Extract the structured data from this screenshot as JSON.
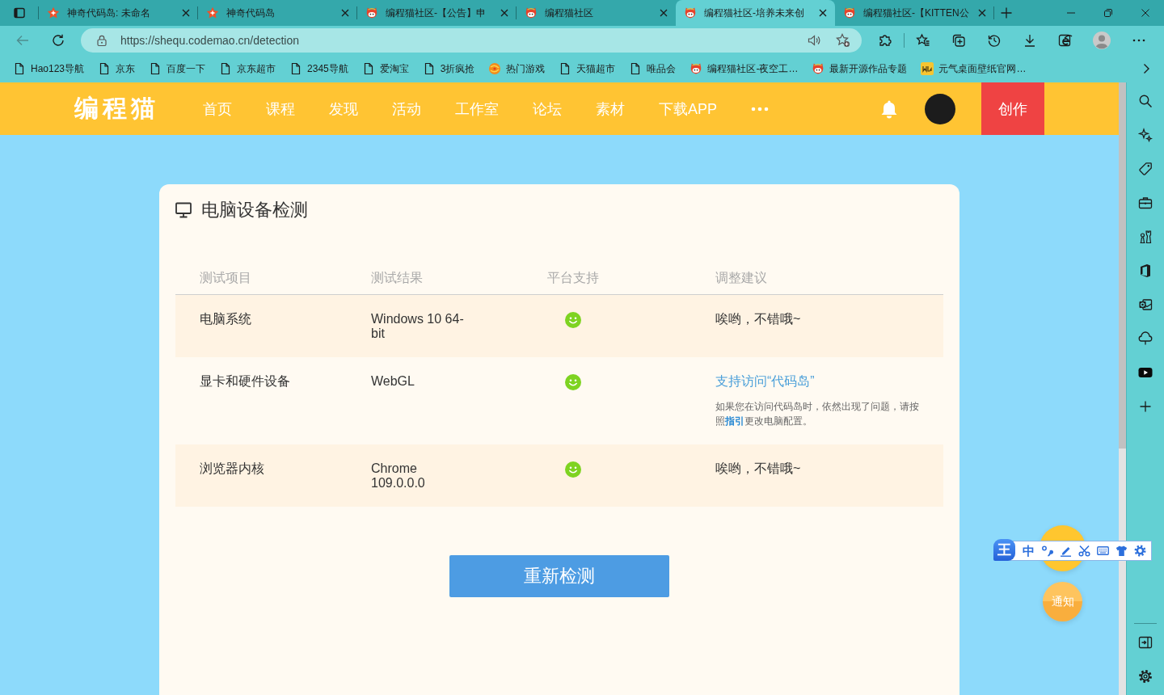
{
  "browser": {
    "tabs": [
      {
        "title": "神奇代码岛: 未命名",
        "kind": "star",
        "selected": false
      },
      {
        "title": "神奇代码岛",
        "kind": "star",
        "selected": false
      },
      {
        "title": "编程猫社区-【公告】申",
        "kind": "mascot",
        "selected": false
      },
      {
        "title": "编程猫社区",
        "kind": "mascot",
        "selected": false
      },
      {
        "title": "编程猫社区-培养未来创",
        "kind": "mascot",
        "selected": true
      },
      {
        "title": "编程猫社区-【KITTEN公",
        "kind": "mascot",
        "selected": false
      }
    ],
    "address_bar": {
      "url": "https://shequ.codemao.cn/detection"
    },
    "bookmarks": [
      {
        "label": "Hao123导航",
        "kind": "page"
      },
      {
        "label": "京东",
        "kind": "page"
      },
      {
        "label": "百度一下",
        "kind": "page"
      },
      {
        "label": "京东超市",
        "kind": "page"
      },
      {
        "label": "2345导航",
        "kind": "page"
      },
      {
        "label": "爱淘宝",
        "kind": "page"
      },
      {
        "label": "3折疯抢",
        "kind": "page"
      },
      {
        "label": "热门游戏",
        "kind": "game"
      },
      {
        "label": "天猫超市",
        "kind": "page"
      },
      {
        "label": "唯品会",
        "kind": "page"
      },
      {
        "label": "编程猫社区-夜空工…",
        "kind": "mascot"
      },
      {
        "label": "最新开源作品专题",
        "kind": "mascot"
      },
      {
        "label": "元气桌面壁纸官网…",
        "kind": "wallpaper"
      }
    ]
  },
  "site_header": {
    "logo": "编程猫",
    "nav": [
      "首页",
      "课程",
      "发现",
      "活动",
      "工作室",
      "论坛",
      "素材",
      "下载APP"
    ],
    "create_button": "创作"
  },
  "detection_card": {
    "title": "电脑设备检测",
    "columns": [
      "测试项目",
      "测试结果",
      "平台支持",
      "调整建议"
    ],
    "rows": [
      {
        "item": "电脑系统",
        "result": "Windows 10 64-bit",
        "supported": true,
        "advice": {
          "kind": "text",
          "text": "唉哟，不错哦~"
        }
      },
      {
        "item": "显卡和硬件设备",
        "result": "WebGL",
        "supported": true,
        "advice": {
          "kind": "link",
          "text": "支持访问“代码岛”"
        },
        "note": {
          "before": "如果您在访问代码岛时，依然出现了问题，请按照",
          "link": "指引",
          "after": "更改电脑配置。"
        }
      },
      {
        "item": "浏览器内核",
        "result": "Chrome 109.0.0.0",
        "supported": true,
        "advice": {
          "kind": "text",
          "text": "唉哟，不错哦~"
        }
      }
    ],
    "recheck_button": "重新检测"
  },
  "floating": {
    "notify_button": "通知"
  },
  "ime_toolbar": {
    "logo": "王",
    "mode": "中"
  }
}
